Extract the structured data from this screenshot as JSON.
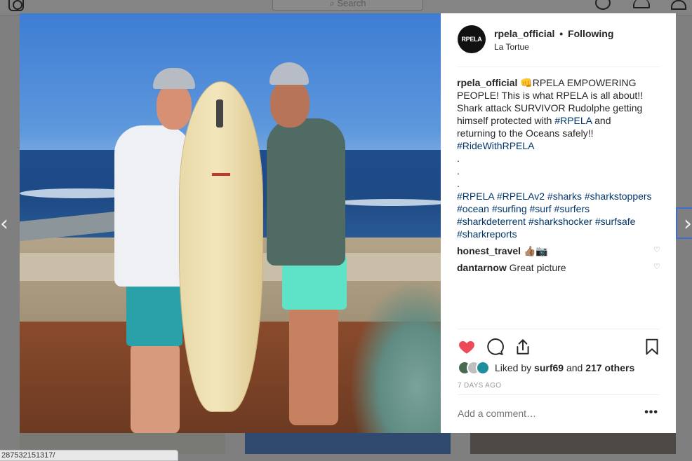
{
  "background": {
    "search_placeholder": "Search",
    "url_preview": "287532151317/"
  },
  "post": {
    "username": "rpela_official",
    "follow_separator": "•",
    "follow_status": "Following",
    "location": "La Tortue",
    "avatar_text": "RPELA",
    "caption": {
      "user": "rpela_official",
      "emoji": "👊",
      "lines": [
        "RPELA EMPOWERING",
        "PEOPLE! This is what RPELA is all about!!",
        "Shark attack SURVIVOR Rudolphe getting",
        "himself protected with ",
        "returning to the Oceans safely!!"
      ],
      "inline_tag": "#RPELA",
      "after_inline_tag": " and",
      "tag_ridewith": "#RideWithRPELA",
      "dots": [
        ".",
        ".",
        "."
      ],
      "hashtag_lines": [
        "#RPELA #RPELAv2 #sharks #sharkstoppers",
        "#ocean #surfing #surf #surfers",
        "#sharkdeterrent #sharkshocker #surfsafe",
        "#sharkreports"
      ]
    },
    "comments": [
      {
        "user": "honest_travel",
        "text": "👍🏽📷"
      },
      {
        "user": "dantarnow",
        "text": "Great picture"
      }
    ],
    "liked_prefix": "Liked by ",
    "liked_user": "surf69",
    "liked_and": " and ",
    "liked_others": "217 others",
    "timestamp": "7 DAYS AGO",
    "add_comment_placeholder": "Add a comment…",
    "more_label": "•••"
  },
  "colors": {
    "like_active": "#ed4956",
    "hashtag": "#003569"
  },
  "icons": {
    "like": "heart-filled-icon",
    "comment": "speech-bubble-icon",
    "share": "share-icon",
    "save": "bookmark-icon",
    "prev": "chevron-left-icon",
    "next": "chevron-right-icon"
  }
}
